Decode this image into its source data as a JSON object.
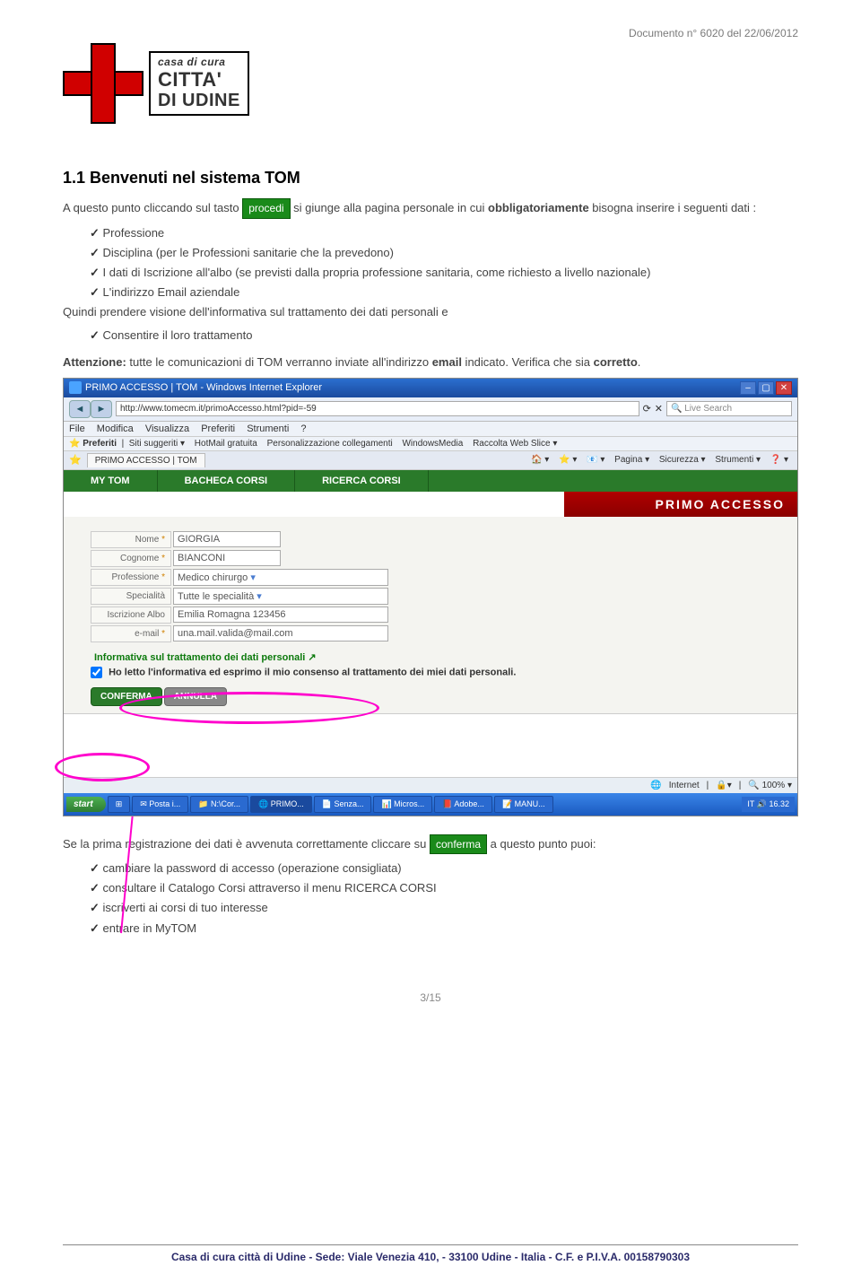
{
  "meta": {
    "doc_line": "Documento n° 6020 del 22/06/2012"
  },
  "logo": {
    "l1": "casa di cura",
    "l2": "CITTA'",
    "l3": "DI UDINE"
  },
  "section_title": "1.1 Benvenuti nel sistema TOM",
  "intro_1": "A questo punto cliccando sul tasto ",
  "procedi_btn": "procedi",
  "intro_2": " si giunge alla pagina personale in cui ",
  "intro_bold": "obbligatoriamente",
  "intro_3": " bisogna inserire i seguenti dati :",
  "bullets1": [
    "Professione",
    "Disciplina (per le Professioni sanitarie che la prevedono)",
    "I dati di Iscrizione all'albo (se previsti dalla propria professione sanitaria, come richiesto a livello nazionale)",
    "L'indirizzo Email aziendale"
  ],
  "quindi": "Quindi prendere visione dell'informativa sul trattamento dei dati personali e",
  "bullets1b": [
    "Consentire il loro trattamento"
  ],
  "attenzione_label": "Attenzione:",
  "attenzione_text1": "tutte le comunicazioni di TOM verranno inviate all'indirizzo ",
  "attenzione_bold": "email",
  "attenzione_text2": " indicato. Verifica che sia ",
  "attenzione_bold2": "corretto",
  "attenzione_text3": ".",
  "browser": {
    "title": "PRIMO ACCESSO | TOM - Windows Internet Explorer",
    "url": "http://www.tomecm.it/primoAccesso.html?pid=-59",
    "search_placeholder": "Live Search",
    "menu": [
      "File",
      "Modifica",
      "Visualizza",
      "Preferiti",
      "Strumenti",
      "?"
    ],
    "fav_label": "Preferiti",
    "fav_items": [
      "Siti suggeriti ▾",
      "HotMail gratuita",
      "Personalizzazione collegamenti",
      "WindowsMedia",
      "Raccolta Web Slice ▾"
    ],
    "ie_tab": "PRIMO ACCESSO | TOM",
    "ie_tools": [
      "🏠 ▾",
      "⭐ ▾",
      "📧 ▾",
      "Pagina ▾",
      "Sicurezza ▾",
      "Strumenti ▾",
      "❓ ▾"
    ],
    "tom_tabs": [
      "MY TOM",
      "BACHECA CORSI",
      "RICERCA CORSI"
    ],
    "primo_accesso": "PRIMO ACCESSO",
    "form": {
      "nome_label": "Nome",
      "nome_val": "GIORGIA",
      "cognome_label": "Cognome",
      "cognome_val": "BIANCONI",
      "prof_label": "Professione",
      "prof_val": "Medico chirurgo",
      "spec_label": "Specialità",
      "spec_val": "Tutte le specialità",
      "albo_label": "Iscrizione Albo",
      "albo_val": "Emilia Romagna 123456",
      "email_label": "e-mail",
      "email_val": "una.mail.valida@mail.com",
      "info_link": "Informativa sul trattamento dei dati personali ↗",
      "consent": "Ho letto l'informativa ed esprimo il mio consenso al trattamento dei miei dati personali.",
      "conferma": "CONFERMA",
      "annulla": "ANNULLA"
    },
    "status": {
      "zone": "Internet",
      "zoom": "100%"
    },
    "taskbar": {
      "start": "start",
      "items": [
        "⊞",
        "✉ Posta i...",
        "📁 N:\\Cor...",
        "🌐 PRIMO...",
        "📄 Senza...",
        "📊 Micros...",
        "📕 Adobe...",
        "📝 MANU..."
      ],
      "tray": "IT  🔊  16.32"
    }
  },
  "tail_1a": "Se la prima registrazione dei dati è avvenuta correttamente cliccare su ",
  "tail_conferma": "conferma",
  "tail_1b": " a questo punto puoi:",
  "bullets2": [
    "cambiare la password di accesso (operazione consigliata)",
    "consultare il Catalogo Corsi attraverso il menu RICERCA CORSI",
    "iscriverti ai corsi di tuo interesse",
    "entrare in MyTOM"
  ],
  "page_num": "3/15",
  "footer": "Casa di cura città di Udine - Sede: Viale Venezia 410, - 33100 Udine - Italia - C.F. e P.I.V.A. 00158790303"
}
